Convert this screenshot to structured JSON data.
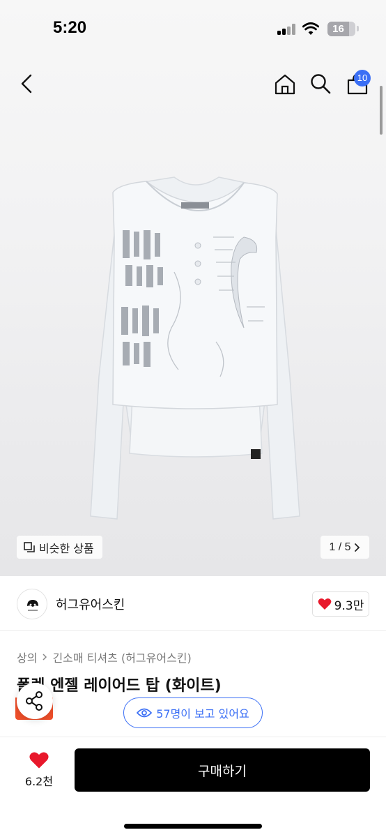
{
  "status_bar": {
    "time": "5:20",
    "battery": "16"
  },
  "header": {
    "cart_count": "10"
  },
  "gallery": {
    "similar_label": "비슷한 상품",
    "page_indicator": "1 / 5"
  },
  "brand": {
    "name": "허그유어스킨",
    "likes": "9.3만"
  },
  "breadcrumb": {
    "items": [
      "상의",
      "긴소매 티셔츠 (허그유어스킨)"
    ]
  },
  "product": {
    "title": "폴렌 엔젤 레이어드 탑 (화이트)"
  },
  "viewers": {
    "label": "57명이 보고 있어요"
  },
  "bottom_bar": {
    "wish_count": "6.2천",
    "buy_label": "구매하기"
  },
  "colors": {
    "accent": "#3b6ff5",
    "heart": "#e8182b",
    "buy_button": "#000000"
  }
}
